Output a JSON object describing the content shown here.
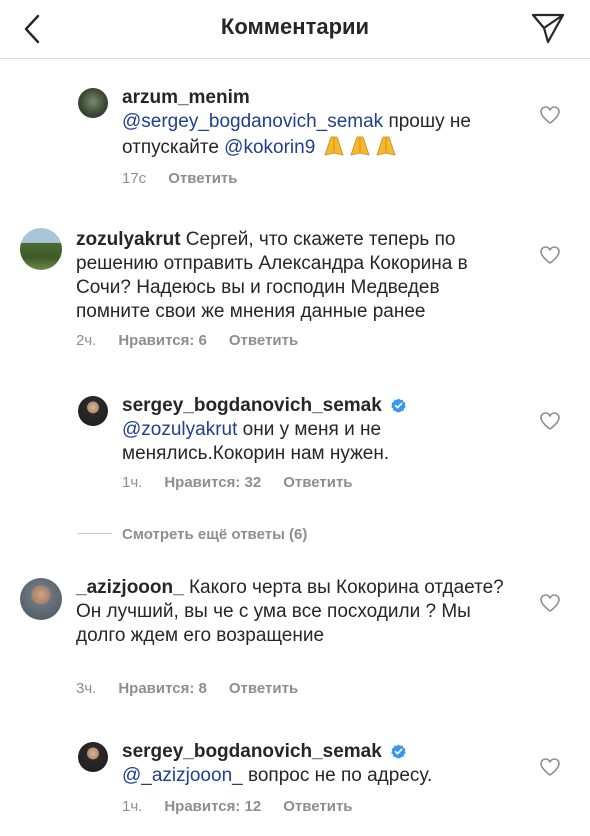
{
  "header": {
    "title": "Комментарии"
  },
  "comments": [
    {
      "username": "arzum_menim",
      "mention": "@sergey_bogdanovich_semak",
      "text": " прошу не отпускайте ",
      "mention2": "@kokorin9",
      "time": "17с",
      "reply": "Ответить"
    },
    {
      "username": "zozulyakrut",
      "text": " Сергей, что скажете теперь по решению отправить Александра Кокорина в Сочи? Надеюсь вы и господин Медведев помните свои же мнения данные ранее",
      "time": "2ч.",
      "likes": "Нравится: 6",
      "reply": "Ответить"
    },
    {
      "username": "sergey_bogdanovich_semak",
      "mention": "@zozulyakrut",
      "text": " они у меня и не менялись.Кокорин нам нужен.",
      "time": "1ч.",
      "likes": "Нравится: 32",
      "reply": "Ответить"
    },
    {
      "username": "_azizjooon_",
      "text": " Какого черта вы Кокорина отдаете? Он лучший, вы че с ума все посходили ? Мы долго ждем его возращение",
      "time": "3ч.",
      "likes": "Нравится: 8",
      "reply": "Ответить"
    },
    {
      "username": "sergey_bogdanovich_semak",
      "mention": "@_azizjooon_",
      "text": " вопрос не по адресу.",
      "time": "1ч.",
      "likes": "Нравится: 12",
      "reply": "Ответить"
    }
  ],
  "more_replies": "Смотреть ещё ответы (6)",
  "colors": {
    "mention": "#1f3f8f",
    "meta": "#8e8e8e",
    "verified": "#3897f0"
  },
  "icons": [
    "chevron-left-icon",
    "send-icon",
    "heart-icon",
    "verified-icon",
    "praying-hands-emoji"
  ]
}
